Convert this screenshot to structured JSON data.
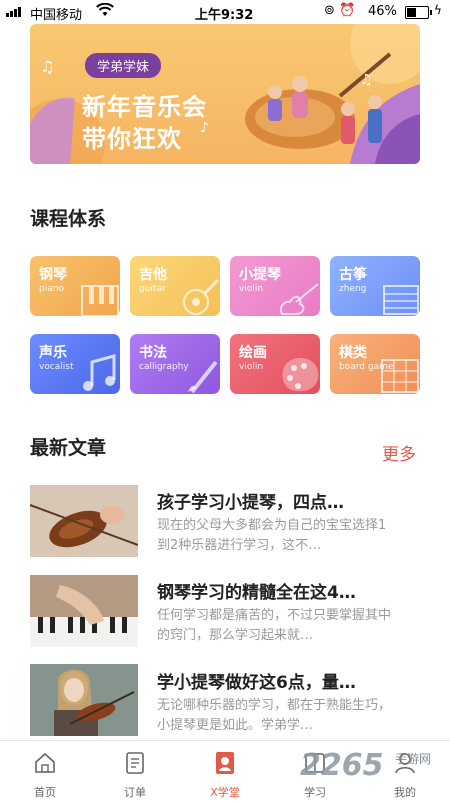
{
  "status": {
    "carrier": "中国移动",
    "time": "上午9:32",
    "battery": "46%"
  },
  "banner": {
    "tag": "学弟学妹",
    "title_line1": "新年音乐会",
    "title_line2": "带你狂欢"
  },
  "courses": {
    "title": "课程体系",
    "items": [
      {
        "name": "钢琴",
        "sub": "piano",
        "icon": "piano-keys-icon",
        "color_top": "#f7c26b",
        "color_bottom": "#f2a54e"
      },
      {
        "name": "吉他",
        "sub": "guitar",
        "icon": "guitar-icon",
        "color_top": "#fbd77a",
        "color_bottom": "#f6c056"
      },
      {
        "name": "小提琴",
        "sub": "violin",
        "icon": "violin-icon",
        "color_top": "#f39ad2",
        "color_bottom": "#e87cc6"
      },
      {
        "name": "古筝",
        "sub": "zheng",
        "icon": "zheng-icon",
        "color_top": "#8fb3ff",
        "color_bottom": "#6e8ff5"
      },
      {
        "name": "声乐",
        "sub": "vocalist",
        "icon": "music-note-icon",
        "color_top": "#6c8cff",
        "color_bottom": "#4c68e8"
      },
      {
        "name": "书法",
        "sub": "calligraphy",
        "icon": "brush-icon",
        "color_top": "#b07cf2",
        "color_bottom": "#8e58e0"
      },
      {
        "name": "绘画",
        "sub": "violin",
        "icon": "palette-icon",
        "color_top": "#f2727f",
        "color_bottom": "#e3505d"
      },
      {
        "name": "棋类",
        "sub": "board game",
        "icon": "board-game-icon",
        "color_top": "#f8b27b",
        "color_bottom": "#f08f56"
      }
    ]
  },
  "articles": {
    "title": "最新文章",
    "more": "更多",
    "items": [
      {
        "title": "孩子学习小提琴，四点…",
        "desc": "现在的父母大多都会为自己的宝宝选择1到2种乐器进行学习，这不…"
      },
      {
        "title": "钢琴学习的精髓全在这4…",
        "desc": "任何学习都是痛苦的，不过只要掌握其中的窍门，那么学习起来就…"
      },
      {
        "title": "学小提琴做好这6点，量…",
        "desc": "无论哪种乐器的学习，都在于熟能生巧，小提琴更是如此。学弟学…"
      }
    ]
  },
  "tabs": [
    {
      "label": "首页",
      "icon": "home-icon"
    },
    {
      "label": "订单",
      "icon": "order-icon"
    },
    {
      "label": "X学堂",
      "icon": "school-icon"
    },
    {
      "label": "学习",
      "icon": "study-icon"
    },
    {
      "label": "我的",
      "icon": "profile-icon"
    }
  ],
  "watermark": {
    "logo": "2265",
    "site": "手游网"
  },
  "colors": {
    "accent": "#e7574c",
    "active_tab": "#e05a47"
  }
}
